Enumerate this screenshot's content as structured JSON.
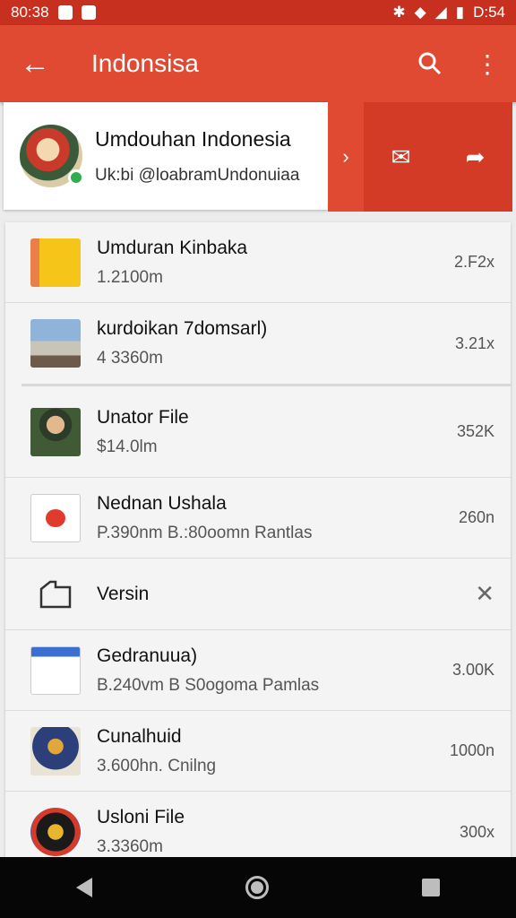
{
  "status_bar": {
    "time_left": "80:38",
    "time_right": "D:54"
  },
  "app_bar": {
    "title": "Indonsisa",
    "back_icon": "arrow-left-icon",
    "search_icon": "search-icon",
    "menu_icon": "more-vert-icon"
  },
  "header": {
    "title": "Umdouhan Indonesia",
    "subtitle": "Uk:bi  @loabramUndonuiaa",
    "actions": [
      "mail-icon",
      "share-icon"
    ]
  },
  "files": [
    {
      "name": "Umduran Kinbaka",
      "meta": "1.2100m",
      "size": "2.F2x"
    },
    {
      "name": "kurdoikan 7domsarl)",
      "meta": "4 3360m",
      "size": "3.21x"
    },
    {
      "name": "Unator File",
      "meta": "$14.0lm",
      "size": "352K"
    },
    {
      "name": "Nednan Ushala",
      "meta": "P.390nm  B.:80oomn Rantlas",
      "size": "260n"
    },
    {
      "name": "Versin",
      "meta": "",
      "size": ""
    },
    {
      "name": "Gedranuua)",
      "meta": "B.240vm  B  S0ogoma Pamlas",
      "size": "3.00K"
    },
    {
      "name": "Cunalhuid",
      "meta": "3.600hn. Cnilng",
      "size": "1000n"
    },
    {
      "name": "Usloni File",
      "meta": "3.3360m",
      "size": "300x"
    }
  ]
}
